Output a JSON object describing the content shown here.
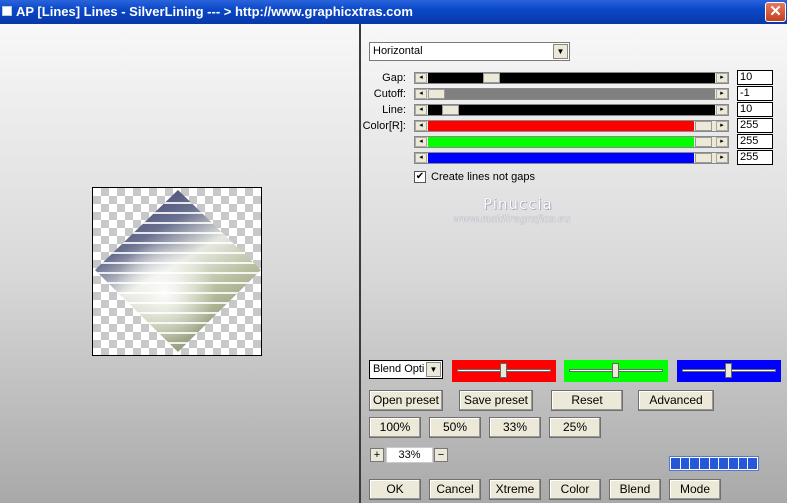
{
  "window": {
    "title": "AP [Lines]  Lines - SilverLining      --- > http://www.graphicxtras.com",
    "close_glyph": "✕"
  },
  "direction": {
    "value": "Horizontal",
    "arrow_glyph": "▼"
  },
  "sliders": [
    {
      "label": "Gap:",
      "value": "10",
      "fill_color": "#000000"
    },
    {
      "label": "Cutoff:",
      "value": "-1",
      "fill_color": "#808080"
    },
    {
      "label": "Line:",
      "value": "10",
      "fill_color": "#000000"
    },
    {
      "label": "Color[R]:",
      "value": "255",
      "fill_color": "#ff0000"
    },
    {
      "label": "",
      "value": "255",
      "fill_color": "#00ff00"
    },
    {
      "label": "",
      "value": "255",
      "fill_color": "#0000ff"
    }
  ],
  "create_lines": {
    "label": "Create lines not gaps",
    "checked": true,
    "check_glyph": "✔"
  },
  "watermark": {
    "name": "Pinuccia",
    "url": "www.maidiregrafica.eu"
  },
  "blend": {
    "select_value": "Blend Opti",
    "red_color": "#ff0000",
    "green_color": "#00ff00",
    "blue_color": "#0000ff"
  },
  "buttons": {
    "open_preset": "Open preset",
    "save_preset": "Save preset",
    "reset": "Reset",
    "advanced": "Advanced",
    "zoom_100": "100%",
    "zoom_50": "50%",
    "zoom_33": "33%",
    "zoom_25": "25%",
    "ok": "OK",
    "cancel": "Cancel",
    "xtreme": "Xtreme",
    "color": "Color",
    "blend": "Blend",
    "mode": "Mode"
  },
  "zoom": {
    "value": "33%",
    "plus": "+",
    "minus": "−"
  },
  "progress": {
    "segments": 9
  }
}
